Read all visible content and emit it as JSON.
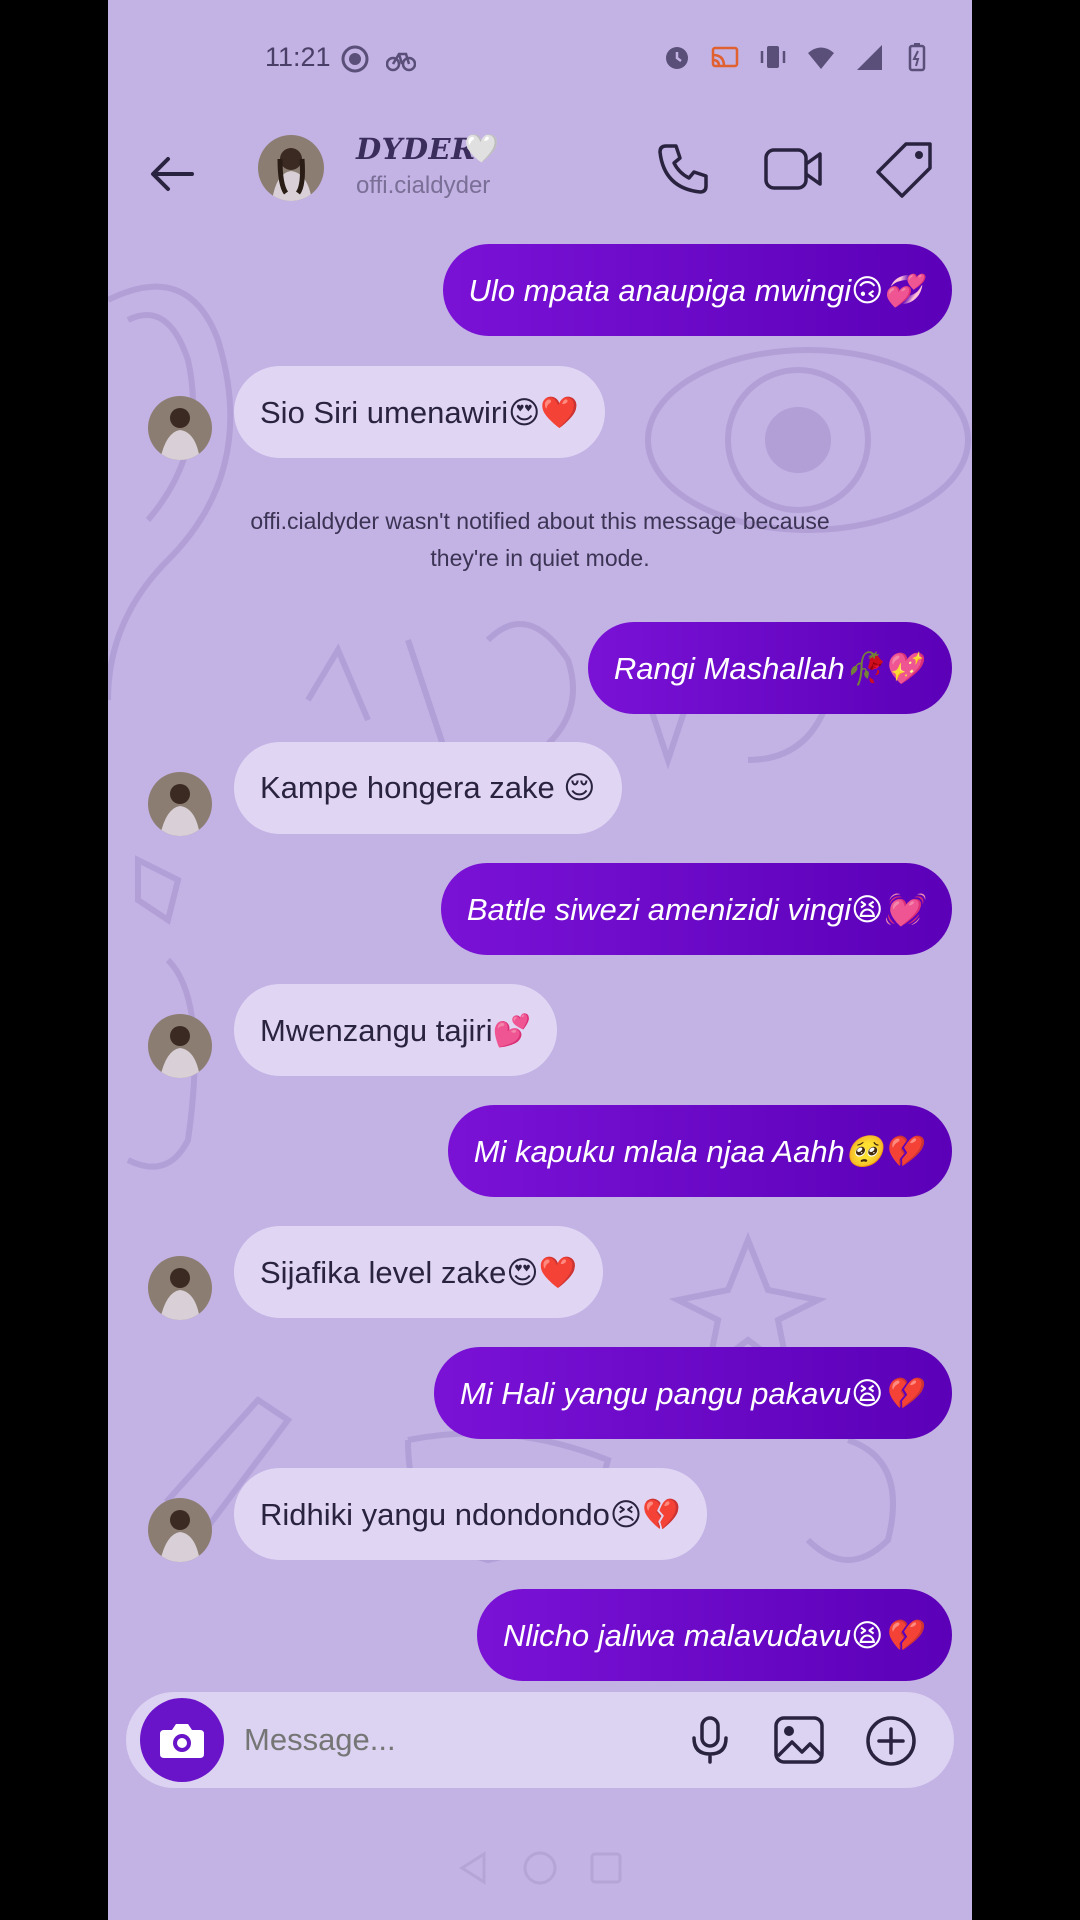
{
  "status": {
    "time": "11:21",
    "left_icons": [
      "record-icon",
      "bike-icon"
    ],
    "right_icons": [
      "alarm-icon",
      "cast-icon",
      "vibrate-icon",
      "wifi-icon",
      "signal-icon",
      "battery-icon"
    ]
  },
  "header": {
    "name": "DYDER",
    "heart": "🤍",
    "username": "offi.cialdyder"
  },
  "messages": [
    {
      "dir": "out",
      "text": "Ulo mpata anaupiga mwingi🙃💞"
    },
    {
      "dir": "in",
      "text": "Sio Siri umenawiri😍❤️"
    },
    {
      "dir": "out",
      "text": "Rangi Mashallah🥀💖"
    },
    {
      "dir": "in",
      "text": "Kampe hongera zake 😌"
    },
    {
      "dir": "out",
      "text": "Battle siwezi amenizidi vingi😫💓"
    },
    {
      "dir": "in",
      "text": "Mwenzangu tajiri💕"
    },
    {
      "dir": "out",
      "text": "Mi kapuku mlala njaa Aahh🥺💔"
    },
    {
      "dir": "in",
      "text": "Sijafika level zake😍❤️"
    },
    {
      "dir": "out",
      "text": "Mi Hali yangu pangu pakavu😫💔"
    },
    {
      "dir": "in",
      "text": "Ridhiki yangu ndondondo😣💔"
    },
    {
      "dir": "out",
      "text": "Nlicho jaliwa malavudavu😫💔"
    }
  ],
  "notice": {
    "line1": "offi.cialdyder wasn't notified about this message because",
    "line2": "they're in quiet mode."
  },
  "composer": {
    "placeholder": "Message..."
  },
  "colors": {
    "background": "#c3b2e4",
    "outgoing_bubble": "#6a0acb",
    "incoming_bubble": "#e0d6f4",
    "accent": "#6a14c9"
  }
}
